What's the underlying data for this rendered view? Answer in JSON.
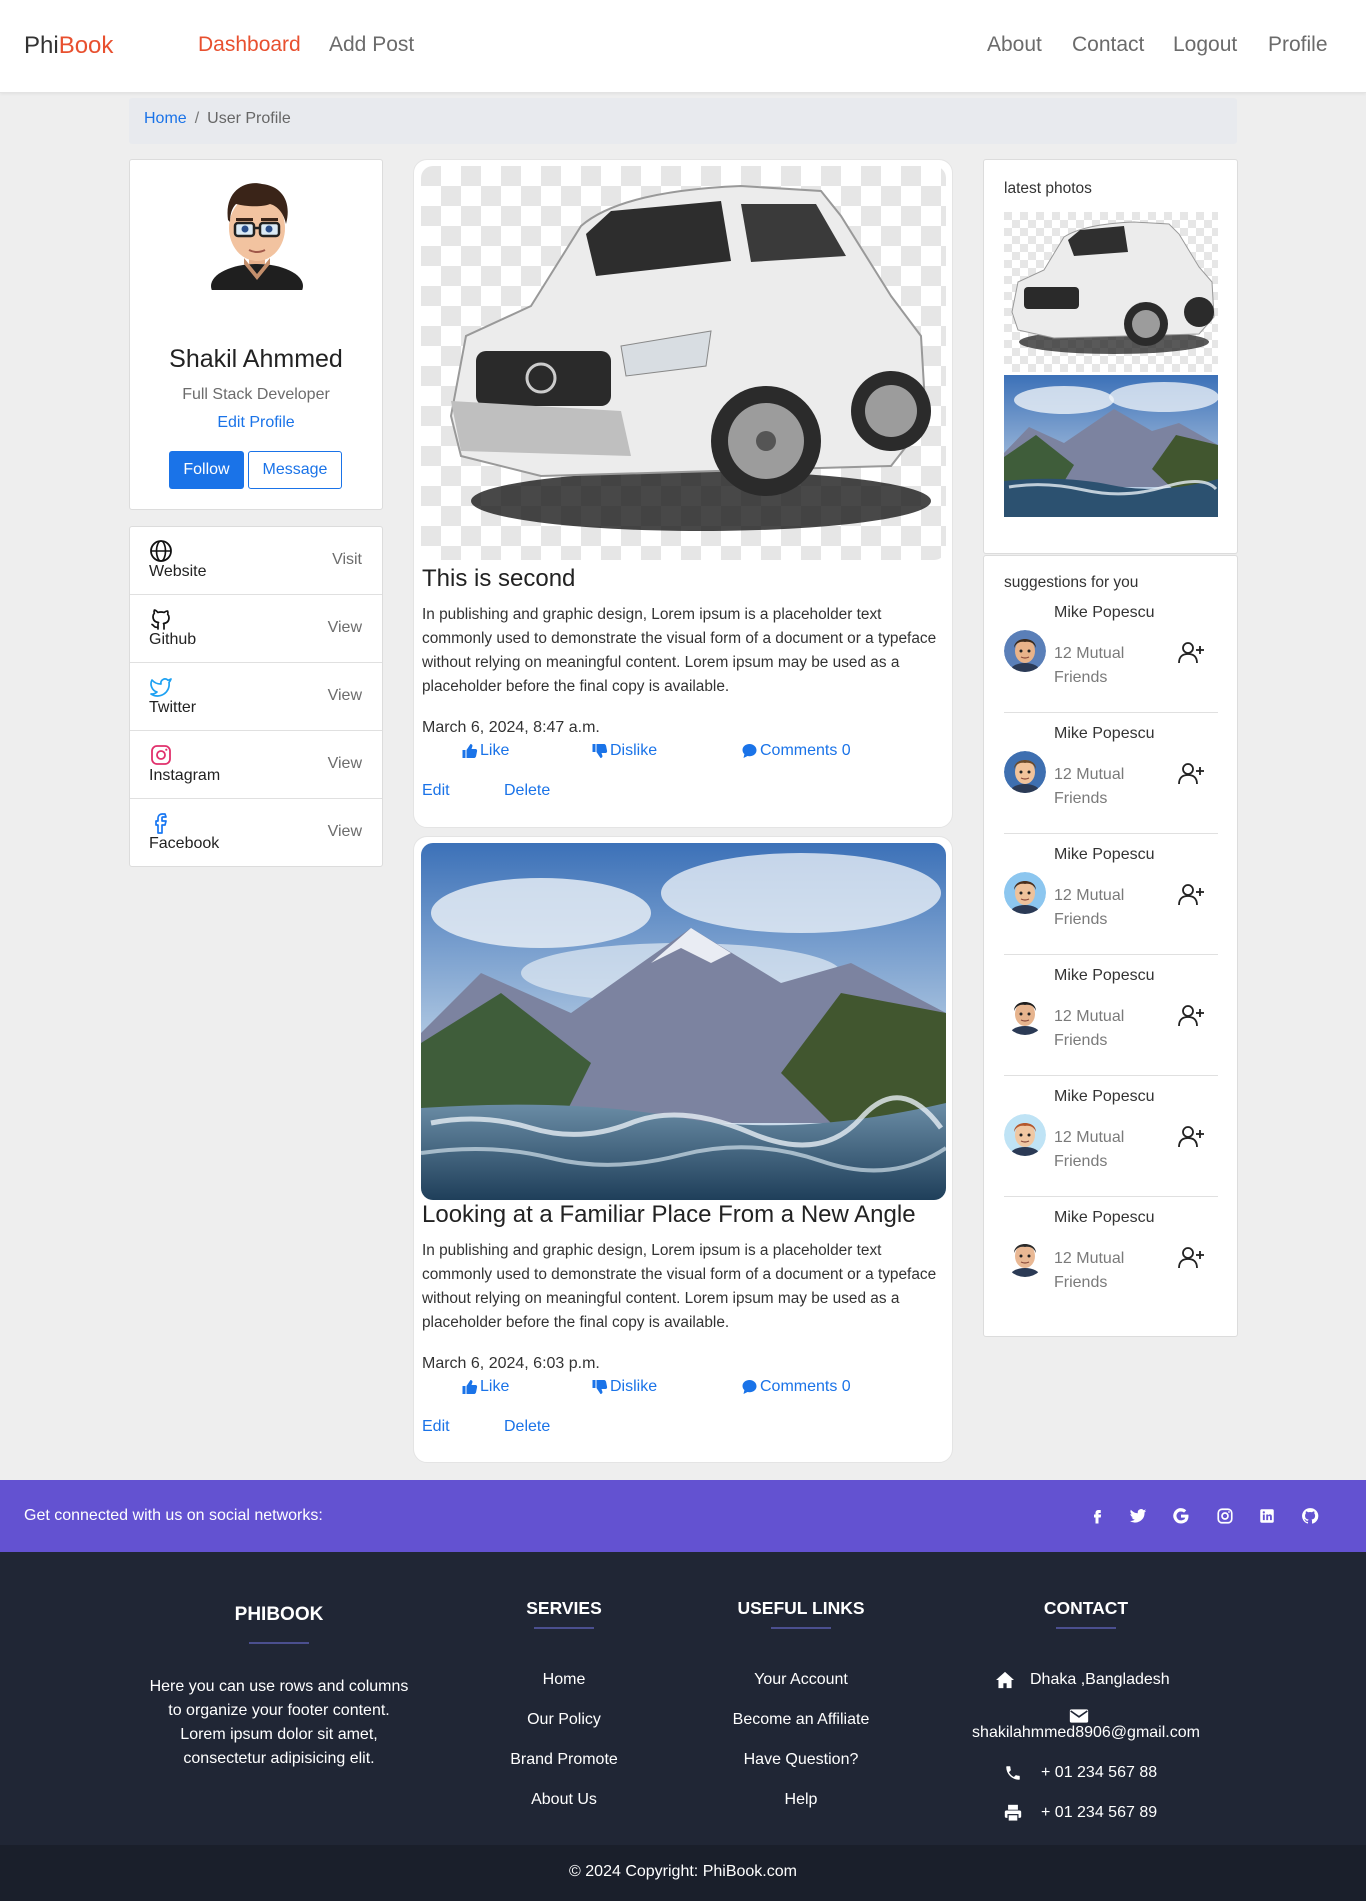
{
  "nav": {
    "brand_phi": "Phi",
    "brand_book": "Book",
    "left": [
      "Dashboard",
      "Add Post"
    ],
    "right": [
      "About",
      "Contact",
      "Logout",
      "Profile"
    ],
    "active_color": "#e8502f"
  },
  "breadcrumb": {
    "home": "Home",
    "separator": "/",
    "current": "User Profile"
  },
  "profile": {
    "name": "Shakil Ahmmed",
    "role": "Full Stack Developer",
    "edit_label": "Edit Profile",
    "follow_label": "Follow",
    "message_label": "Message"
  },
  "social_links": [
    {
      "icon": "globe-icon",
      "label": "Website",
      "action": "Visit"
    },
    {
      "icon": "github-icon",
      "label": "Github",
      "action": "View"
    },
    {
      "icon": "twitter-icon",
      "label": "Twitter",
      "action": "View"
    },
    {
      "icon": "instagram-icon",
      "label": "Instagram",
      "action": "View"
    },
    {
      "icon": "facebook-icon",
      "label": "Facebook",
      "action": "View"
    }
  ],
  "posts": [
    {
      "image": "white-suv-car-image",
      "title": "This is second",
      "body": "In publishing and graphic design, Lorem ipsum is a placeholder text commonly used to demonstrate the visual form of a document or a typeface without relying on meaningful content. Lorem ipsum may be used as a placeholder before the final copy is available.",
      "date": "March 6, 2024, 8:47 a.m.",
      "like_label": "Like",
      "dislike_label": "Dislike",
      "comments_label": "Comments 0",
      "edit_label": "Edit",
      "delete_label": "Delete"
    },
    {
      "image": "mountain-lake-image",
      "title": "Looking at a Familiar Place From a New Angle",
      "body": "In publishing and graphic design, Lorem ipsum is a placeholder text commonly used to demonstrate the visual form of a document or a typeface without relying on meaningful content. Lorem ipsum may be used as a placeholder before the final copy is available.",
      "date": "March 6, 2024, 6:03 p.m.",
      "like_label": "Like",
      "dislike_label": "Dislike",
      "comments_label": "Comments 0",
      "edit_label": "Edit",
      "delete_label": "Delete"
    }
  ],
  "sidebar": {
    "photos_title": "latest photos",
    "suggestions_title": "suggestions for you",
    "suggestions": [
      {
        "name": "Mike Popescu",
        "mutual": "12 Mutual Friends"
      },
      {
        "name": "Mike Popescu",
        "mutual": "12 Mutual Friends"
      },
      {
        "name": "Mike Popescu",
        "mutual": "12 Mutual Friends"
      },
      {
        "name": "Mike Popescu",
        "mutual": "12 Mutual Friends"
      },
      {
        "name": "Mike Popescu",
        "mutual": "12 Mutual Friends"
      },
      {
        "name": "Mike Popescu",
        "mutual": "12 Mutual Friends"
      }
    ]
  },
  "social_bar": {
    "text": "Get connected with us on social networks:",
    "icons": [
      "facebook-icon",
      "twitter-icon",
      "google-icon",
      "instagram-icon",
      "linkedin-icon",
      "github-icon"
    ],
    "color": "#6352d1"
  },
  "footer": {
    "brand": "PHIBOOK",
    "about": "Here you can use rows and columns to organize your footer content. Lorem ipsum dolor sit amet, consectetur adipisicing elit.",
    "services_title": "SERVIES",
    "services": [
      "Home",
      "Our Policy",
      "Brand Promote",
      "About Us"
    ],
    "useful_title": "USEFUL LINKS",
    "useful": [
      "Your Account",
      "Become an Affiliate",
      "Have Question?",
      "Help"
    ],
    "contact_title": "CONTACT",
    "address": "Dhaka ,Bangladesh",
    "email": "shakilahmmed8906@gmail.com",
    "phone": "+ 01 234 567 88",
    "fax": "+ 01 234 567 89",
    "copyright": "© 2024 Copyright: PhiBook.com",
    "background": "#202635"
  }
}
